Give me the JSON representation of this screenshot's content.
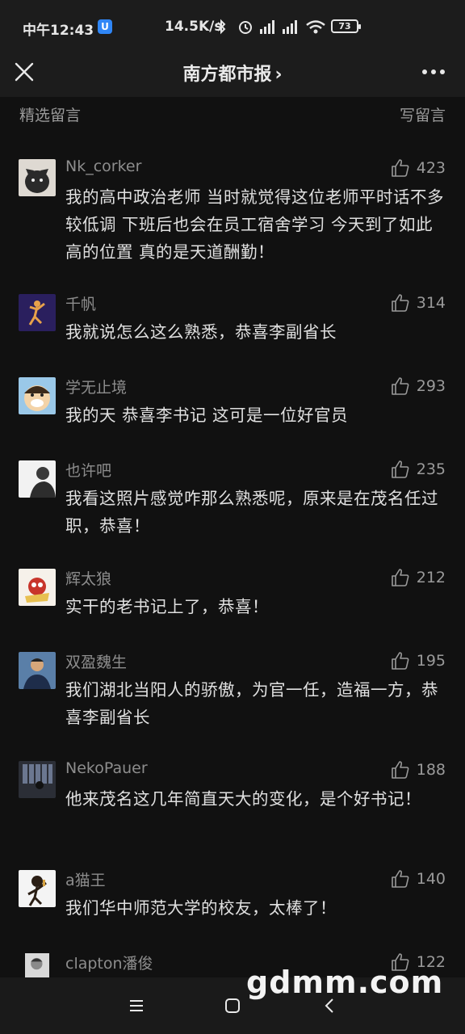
{
  "status_bar": {
    "time": "中午12:43",
    "net_speed": "14.5K/s",
    "battery": "73"
  },
  "header": {
    "title": "南方都市报",
    "title_chevron": "›"
  },
  "section": {
    "title": "精选留言",
    "write_label": "写留言"
  },
  "comments": [
    {
      "user": "Nk_corker",
      "likes": "423",
      "text": "我的高中政治老师 当时就觉得这位老师平时话不多 较低调 下班后也会在员工宿舍学习 今天到了如此高的位置 真的是天道酬勤！",
      "avatar": "dog-avatar"
    },
    {
      "user": "千帆",
      "likes": "314",
      "text": "我就说怎么这么熟悉，恭喜李副省长",
      "avatar": "basketball-avatar"
    },
    {
      "user": "学无止境",
      "likes": "293",
      "text": "我的天 恭喜李书记 这可是一位好官员",
      "avatar": "cartoon-avatar"
    },
    {
      "user": "也许吧",
      "likes": "235",
      "text": "我看这照片感觉咋那么熟悉呢，原来是在茂名任过职，恭喜！",
      "avatar": "photo-avatar"
    },
    {
      "user": "辉太狼",
      "likes": "212",
      "text": "实干的老书记上了，恭喜！",
      "avatar": "wolf-avatar"
    },
    {
      "user": "双盈魏生",
      "likes": "195",
      "text": "我们湖北当阳人的骄傲，为官一任，造福一方，恭喜李副省长",
      "avatar": "man-avatar"
    },
    {
      "user": "NekoPauer",
      "likes": "188",
      "text": "他来茂名这几年简直天大的变化，是个好书记！",
      "avatar": "window-avatar"
    },
    {
      "user": "a猫王",
      "likes": "140",
      "text": "我们华中师范大学的校友，太棒了！",
      "avatar": "singer-avatar"
    },
    {
      "user": "clapton潘俊",
      "likes": "122",
      "text": "",
      "avatar": "portrait-avatar"
    }
  ],
  "watermark": "gdmm.com",
  "colors": {
    "background": "#111111",
    "header_bg": "#1c1c1c",
    "text_primary": "#e0e0e0",
    "text_secondary": "#8d8d8d"
  }
}
